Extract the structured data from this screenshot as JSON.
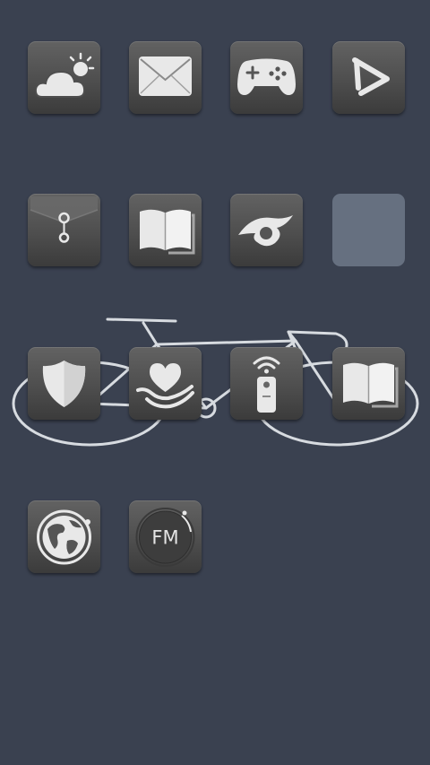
{
  "home_screen": {
    "wallpaper": {
      "name": "bicycle-outline",
      "background_color": "#3a4150",
      "line_color": "#d7dbe0"
    },
    "icon_color": "#e8e8e8",
    "empty_slot_color": "#667080",
    "rows": [
      {
        "apps": [
          {
            "icon": "weather-icon"
          },
          {
            "icon": "mail-icon"
          },
          {
            "icon": "gamepad-icon"
          },
          {
            "icon": "video-player-icon"
          }
        ]
      },
      {
        "apps": [
          {
            "icon": "folder-envelope-icon"
          },
          {
            "icon": "book-icon"
          },
          {
            "icon": "eye-swirl-icon"
          },
          {
            "icon": "empty-slot"
          }
        ]
      },
      {
        "apps": [
          {
            "icon": "shield-icon"
          },
          {
            "icon": "heart-hand-icon"
          },
          {
            "icon": "remote-control-icon"
          },
          {
            "icon": "book-icon"
          }
        ]
      },
      {
        "apps": [
          {
            "icon": "globe-icon"
          },
          {
            "icon": "fm-radio-icon",
            "label": "FM"
          }
        ]
      }
    ]
  }
}
